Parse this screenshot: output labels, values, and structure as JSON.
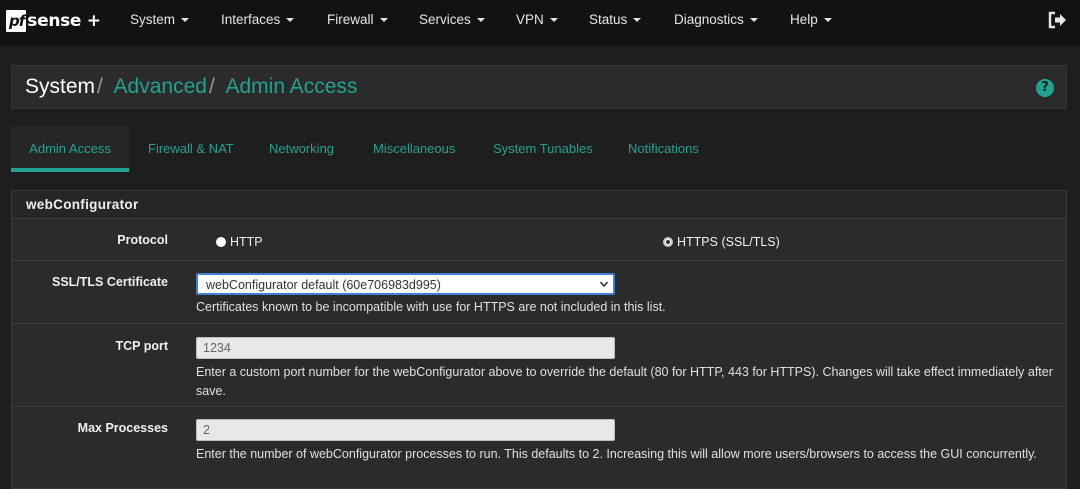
{
  "brand": {
    "pf": "pf",
    "rest": "sense +"
  },
  "nav": {
    "items": [
      {
        "label": "System"
      },
      {
        "label": "Interfaces"
      },
      {
        "label": "Firewall"
      },
      {
        "label": "Services"
      },
      {
        "label": "VPN"
      },
      {
        "label": "Status"
      },
      {
        "label": "Diagnostics"
      },
      {
        "label": "Help"
      }
    ],
    "logout_icon": "logout-icon"
  },
  "breadcrumb": {
    "root": "System",
    "sep": "/",
    "advanced": "Advanced",
    "current": "Admin Access",
    "help": "?"
  },
  "tabs": [
    {
      "label": "Admin Access",
      "active": true
    },
    {
      "label": "Firewall & NAT"
    },
    {
      "label": "Networking"
    },
    {
      "label": "Miscellaneous"
    },
    {
      "label": "System Tunables"
    },
    {
      "label": "Notifications"
    }
  ],
  "panel": {
    "title": "webConfigurator",
    "protocol": {
      "label": "Protocol",
      "option_http": "HTTP",
      "option_https": "HTTPS (SSL/TLS)",
      "selected": "HTTPS (SSL/TLS)"
    },
    "certificate": {
      "label": "SSL/TLS Certificate",
      "selected": "webConfigurator default (60e706983d995)",
      "help": "Certificates known to be incompatible with use for HTTPS are not included in this list."
    },
    "tcp_port": {
      "label": "TCP port",
      "placeholder": "1234",
      "help": "Enter a custom port number for the webConfigurator above to override the default (80 for HTTP, 443 for HTTPS). Changes will take effect immediately after save."
    },
    "max_processes": {
      "label": "Max Processes",
      "placeholder": "2",
      "help": "Enter the number of webConfigurator processes to run. This defaults to 2. Increasing this will allow more users/browsers to access the GUI concurrently."
    }
  },
  "colors": {
    "accent": "#20a393",
    "background": "#1e1e1e",
    "navbar": "#121212",
    "panel": "#2b2b2b"
  }
}
